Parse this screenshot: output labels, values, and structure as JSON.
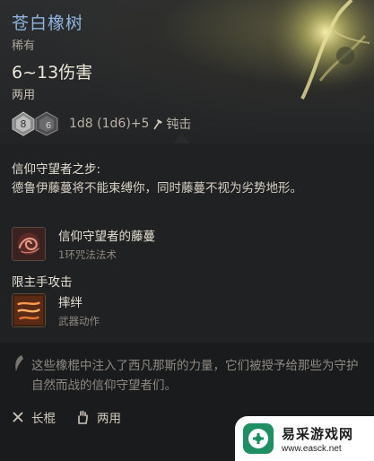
{
  "item": {
    "name": "苍白橡树",
    "rarity": "稀有",
    "damage": "6~13伤害",
    "handed": "两用",
    "dice_text": "1d8 (1d6)+5",
    "damage_type": "钝击",
    "dice_big": "8",
    "dice_small": "6"
  },
  "feature": {
    "title": "信仰守望者之步:",
    "description": "德鲁伊藤蔓将不能束缚你，同时藤蔓不视为劣势地形。"
  },
  "abilities": [
    {
      "name": "信仰守望者的藤蔓",
      "sub": "1环咒法法术",
      "icon": "vine-spell-icon"
    },
    {
      "name": "摔绊",
      "sub": "武器动作",
      "icon": "topple-action-icon"
    }
  ],
  "main_hand_label": "限主手攻击",
  "lore": "这些橡棍中注入了西凡那斯的力量，它们被授予给那些为守护自然而战的信仰守望者们。",
  "footer": {
    "weapon_type": "长棍",
    "hand_type": "两用"
  },
  "watermark": {
    "name_cn": "易采游戏网",
    "url": "www.easck.net"
  },
  "colors": {
    "name": "#8fb4df",
    "background": "#1b1a1c",
    "watermark_green": "#1f8f63"
  }
}
